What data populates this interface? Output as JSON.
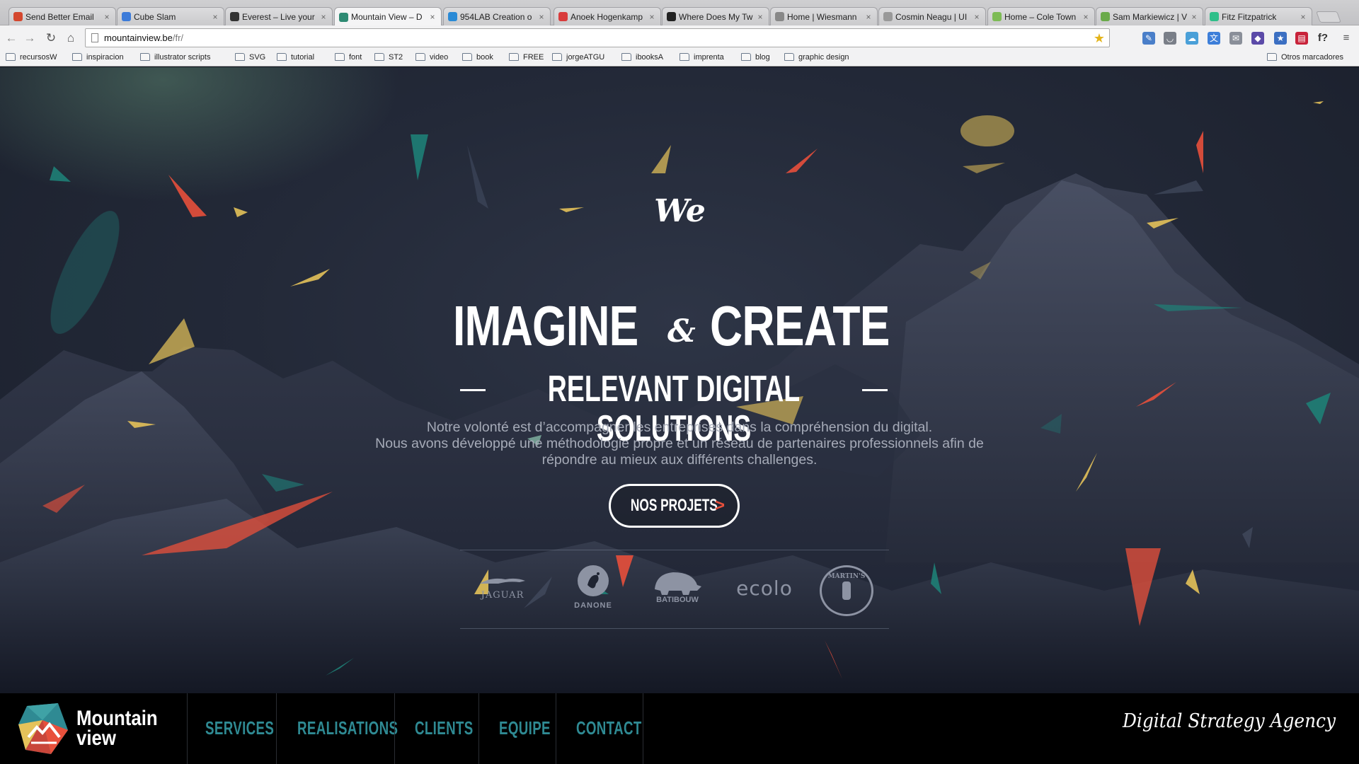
{
  "browser": {
    "tabs": [
      {
        "label": "Send Better Email",
        "icon_color": "#d4472e"
      },
      {
        "label": "Cube Slam",
        "icon_color": "#3c7bd9"
      },
      {
        "label": "Everest – Live your",
        "icon_color": "#333333"
      },
      {
        "label": "Mountain View – D",
        "icon_color": "#2e8a73",
        "active": true
      },
      {
        "label": "954LAB Creation o",
        "icon_color": "#2a8ad6"
      },
      {
        "label": "Anoek Hogenkamp",
        "icon_color": "#d93b3b"
      },
      {
        "label": "Where Does My Tw",
        "icon_color": "#222222"
      },
      {
        "label": "Home | Wiesmann",
        "icon_color": "#888888"
      },
      {
        "label": "Cosmin Neagu | UI",
        "icon_color": "#999999"
      },
      {
        "label": "Home – Cole Town",
        "icon_color": "#7dbb55"
      },
      {
        "label": "Sam Markiewicz | V",
        "icon_color": "#6aaa4a"
      },
      {
        "label": "Fitz Fitzpatrick",
        "icon_color": "#2fbf8a"
      }
    ],
    "close_glyph": "×",
    "url_host": "mountainview.be",
    "url_path": "/fr/",
    "bookmarks": [
      "recursosW",
      "inspiracion",
      "illustrator scripts",
      "SVG",
      "tutorial",
      "font",
      "ST2",
      "video",
      "book",
      "FREE",
      "jorgeATGU",
      "ibooksA",
      "imprenta",
      "blog",
      "graphic design"
    ],
    "other_bookmarks": "Otros marcadores",
    "extensions": [
      {
        "name": "eyedropper-icon",
        "color": "#4a7fc9",
        "glyph": "✎"
      },
      {
        "name": "pocket-icon",
        "color": "#7a7f88",
        "glyph": "◡"
      },
      {
        "name": "chat-icon",
        "color": "#4aa0d8",
        "glyph": "☁"
      },
      {
        "name": "translate-icon",
        "color": "#3d7fd9",
        "glyph": "文"
      },
      {
        "name": "mail-icon",
        "color": "#8a8f99",
        "glyph": "✉"
      },
      {
        "name": "extension-purple-icon",
        "color": "#5b4aa8",
        "glyph": "◆"
      },
      {
        "name": "bookmark-star-icon",
        "color": "#3b6fc2",
        "glyph": "★"
      },
      {
        "name": "extension-red-icon",
        "color": "#c8233a",
        "glyph": "▤"
      },
      {
        "name": "whatfont-icon",
        "color": "#333333",
        "glyph": "f?"
      },
      {
        "name": "menu-icon",
        "color": "#555555",
        "glyph": "≡"
      }
    ]
  },
  "hero": {
    "we": "We",
    "imagine": "IMAGINE",
    "ampersand": "&",
    "create": "CREATE",
    "subline": "RELEVANT DIGITAL SOLUTIONS",
    "intro_line1": "Notre volonté est d’accompagner les entreprises dans la compréhension du digital.",
    "intro_line2": "Nous avons développé une méthodologie propre et un réseau de partenaires professionnels afin de",
    "intro_line3": "répondre au mieux aux différents challenges.",
    "cta_label": "NOS PROJETS",
    "cta_arrow": ">",
    "client_logos": [
      "JAGUAR",
      "DANONE",
      "BATIBOUW",
      "ecolo",
      "MARTIN'S"
    ]
  },
  "nav": {
    "brand_line1": "Mountain",
    "brand_line2": "view",
    "links": [
      "SERVICES",
      "REALISATIONS",
      "CLIENTS",
      "EQUIPE",
      "CONTACT"
    ],
    "tagline": "Digital Strategy Agency"
  },
  "colors": {
    "accent_teal": "#2f8a93",
    "accent_red": "#e8503c",
    "accent_yellow": "#e5c25a",
    "hero_bg": "#232938"
  }
}
